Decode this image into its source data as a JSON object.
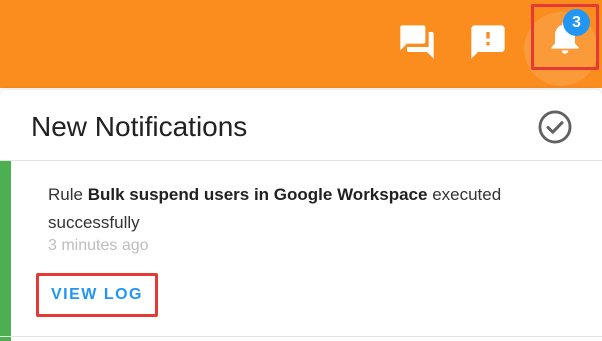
{
  "topbar": {
    "color": "#fb8c1e",
    "icons": [
      "chat-icon",
      "feedback-icon",
      "bell-icon"
    ],
    "notification_count": "3"
  },
  "panel": {
    "title": "New Notifications",
    "mark_all_read_icon": "check-circle-icon"
  },
  "notifications": [
    {
      "prefix": "Rule ",
      "rule_name": "Bulk suspend users in Google Workspace",
      "suffix": " executed successfully",
      "time": "3 minutes ago",
      "action_label": "VIEW LOG",
      "status_color": "#4caf50"
    }
  ],
  "colors": {
    "accent": "#2196f3",
    "highlight_box": "#e53935"
  }
}
